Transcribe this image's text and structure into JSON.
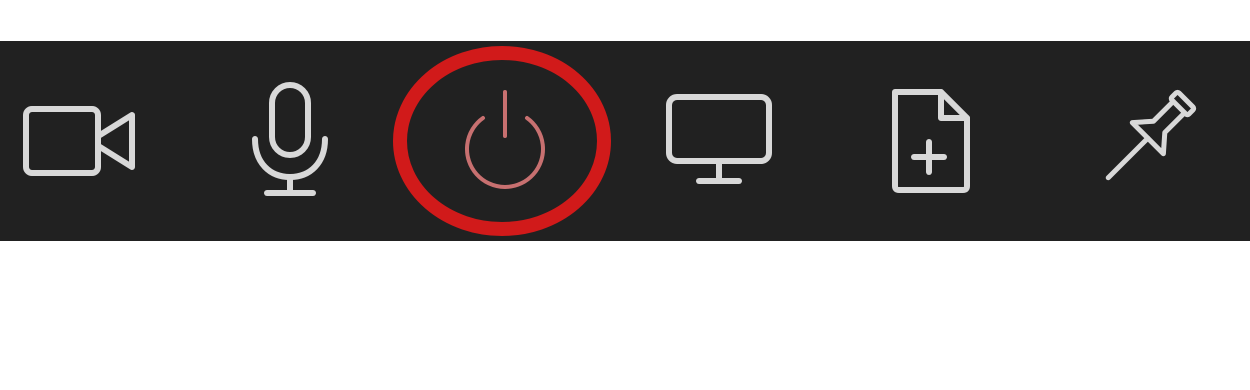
{
  "colors": {
    "toolbar_background": "#212121",
    "page_background": "#ffffff",
    "icon_color": "#d8d8d8",
    "power_icon_color": "#c87070",
    "highlight_ring_color": "#d11a1a"
  },
  "toolbar": {
    "buttons": [
      {
        "id": "camera",
        "icon": "video-camera-icon"
      },
      {
        "id": "microphone",
        "icon": "microphone-icon"
      },
      {
        "id": "power",
        "icon": "power-icon",
        "highlighted": true
      },
      {
        "id": "screen-share",
        "icon": "monitor-icon"
      },
      {
        "id": "new-file",
        "icon": "file-add-icon"
      },
      {
        "id": "pin",
        "icon": "pushpin-icon"
      }
    ]
  }
}
